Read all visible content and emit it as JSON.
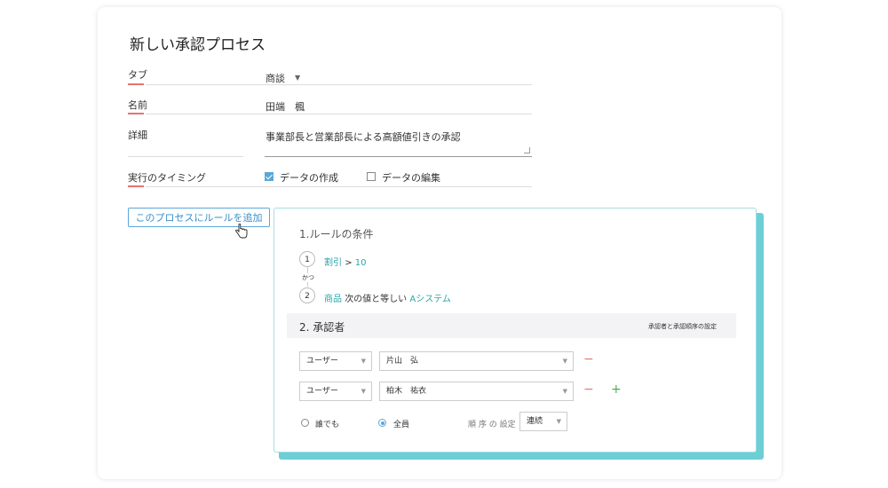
{
  "page": {
    "title": "新しい承認プロセス"
  },
  "form": {
    "tab": {
      "label": "タブ",
      "value": "商談"
    },
    "name": {
      "label": "名前",
      "value": "田端　楓"
    },
    "detail": {
      "label": "詳細",
      "value": "事業部長と営業部長による高額値引きの承認"
    },
    "timing": {
      "label": "実行のタイミング",
      "options": [
        {
          "label": "データの作成",
          "checked": true
        },
        {
          "label": "データの編集",
          "checked": false
        }
      ]
    }
  },
  "add_rule_button": "このプロセスにルールを追加",
  "rule_panel": {
    "conditions_title": "1.ルールの条件",
    "conditions": [
      {
        "num": "1",
        "field": "割引",
        "operator": ">",
        "value": "10"
      },
      {
        "num": "2",
        "field": "商品",
        "operator": "次の値と等しい",
        "value": "Aシステム"
      }
    ],
    "and_label": "かつ",
    "approvers_title": "2. 承認者",
    "approvers_settings_link": "承認者と承認順序の設定",
    "approvers": [
      {
        "type": "ユーザー",
        "user": "片山　弘"
      },
      {
        "type": "ユーザー",
        "user": "柏木　祐衣"
      }
    ],
    "approval_mode": {
      "options": [
        {
          "label": "誰でも",
          "selected": false
        },
        {
          "label": "全員",
          "selected": true
        }
      ],
      "order_label": "順 序 の 設定",
      "order_value": "連続"
    }
  },
  "colors": {
    "accent_blue": "#5aa7d8",
    "teal": "#2aa5a8",
    "panel_shadow": "#6ccfd6",
    "required_red": "#e57373",
    "add_green": "#4caf50"
  }
}
